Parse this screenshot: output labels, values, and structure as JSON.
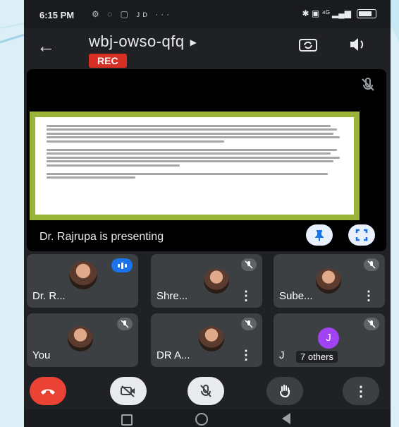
{
  "status_bar": {
    "time": "6:15 PM",
    "left_icons": "⚙ ◌ ▢ ᴊᴅ ···",
    "right_icons": "✱ ▣ ⁴ᴳ ▂▄▆"
  },
  "header": {
    "meeting_code": "wbj-owso-qfq",
    "rec_label": "REC"
  },
  "presentation": {
    "presenter_label": "Dr. Rajrupa is presenting"
  },
  "participants": [
    {
      "name": "Dr. R...",
      "speaking": true
    },
    {
      "name": "Shre...",
      "muted": true
    },
    {
      "name": "Sube...",
      "muted": true
    },
    {
      "name": "You",
      "muted": true
    },
    {
      "name": "DR A...",
      "muted": true
    },
    {
      "name": "J",
      "avatar_letter": "J",
      "others_label": "7 others",
      "muted": true
    }
  ],
  "colors": {
    "background": "#202124",
    "tile": "#3c4043",
    "rec": "#d93025",
    "end_call": "#ea4335",
    "speaking": "#1a73e8",
    "slide_border": "#9ab43a",
    "avatar_j": "#a142f4"
  },
  "icons": {
    "back": "arrow-left-icon",
    "camera_switch": "camera-switch-icon",
    "speaker": "volume-icon",
    "mic_off": "mic-off-icon",
    "pin": "pin-icon",
    "fullscreen": "fullscreen-icon",
    "end_call": "phone-hangup-icon",
    "camera_off": "camera-off-icon",
    "raise_hand": "hand-icon",
    "more": "more-vertical-icon"
  }
}
